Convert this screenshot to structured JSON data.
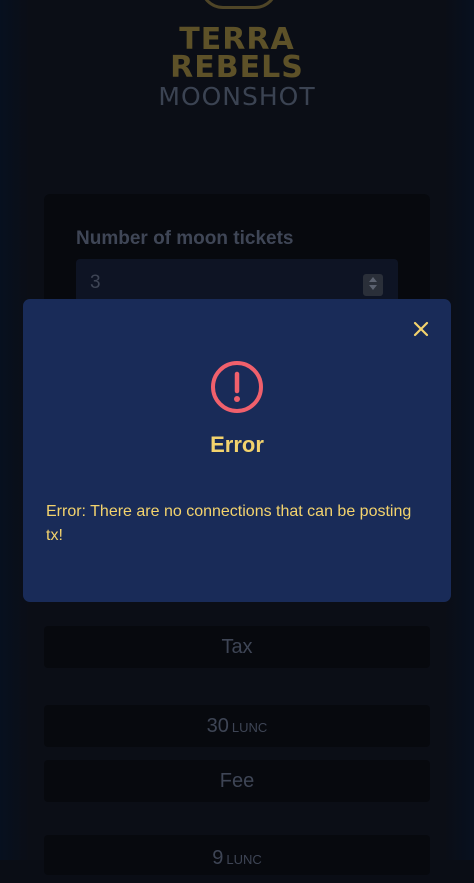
{
  "brand": {
    "line1": "TERRA",
    "line2": "REBELS",
    "subtitle": "MOONSHOT"
  },
  "form": {
    "tickets_label": "Number of moon tickets",
    "tickets_value": "3"
  },
  "summary": {
    "tax_label": "Tax",
    "tax_value": "30",
    "tax_unit": "LUNC",
    "fee_label": "Fee",
    "fee_value": "9",
    "fee_unit": "LUNC"
  },
  "modal": {
    "title": "Error",
    "message": "Error: There are no connections that can be posting tx!",
    "close_icon": "close-icon",
    "status_icon": "error-circle-icon"
  },
  "colors": {
    "modal_bg": "#192b58",
    "accent": "#f3d36d",
    "error": "#f0606c"
  }
}
